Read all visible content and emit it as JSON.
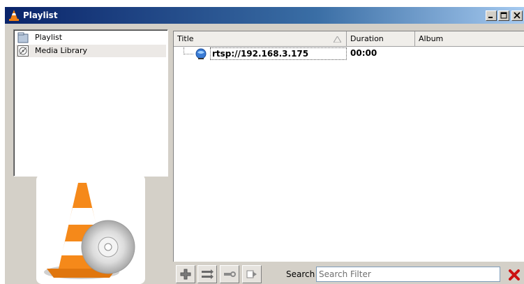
{
  "window": {
    "title": "Playlist"
  },
  "sidebar": {
    "items": [
      {
        "label": "Playlist",
        "icon": "playlist-icon"
      },
      {
        "label": "Media Library",
        "icon": "media-library-icon"
      }
    ]
  },
  "playlist": {
    "columns": [
      "Title",
      "Duration",
      "Album"
    ],
    "rows": [
      {
        "title": "rtsp://192.168.3.175",
        "duration": "00:00",
        "album": ""
      }
    ]
  },
  "toolbar": {
    "buttons": [
      "add-icon",
      "shuffle-icon",
      "remove-icon",
      "sort-icon"
    ],
    "search_label": "Search",
    "search_placeholder": "Search Filter"
  },
  "colors": {
    "titlebar_start": "#0a246a",
    "titlebar_end": "#a6caf0",
    "cone_orange": "#f07f13",
    "clear_red": "#cc1111"
  }
}
